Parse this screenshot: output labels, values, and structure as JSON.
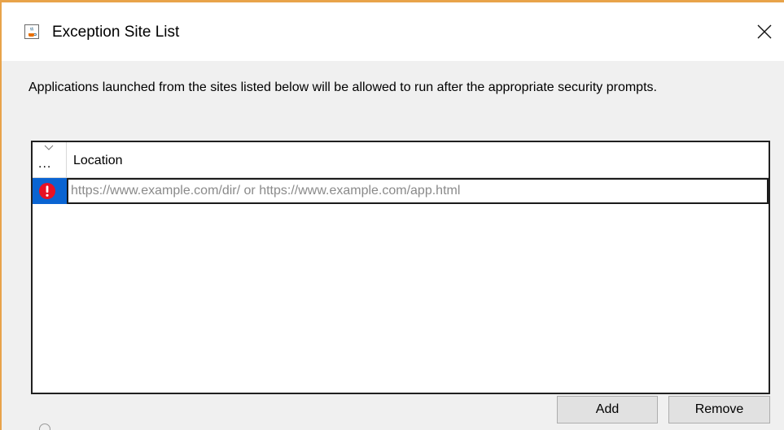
{
  "window": {
    "title": "Exception Site List",
    "accent_color": "#e8a34a"
  },
  "icons": {
    "app": "java-cup-icon",
    "close": "close-icon",
    "sort": "chevron-down-icon",
    "warning": "error-icon"
  },
  "description": "Applications launched from the sites listed below will be allowed to run after the appropriate security prompts.",
  "table": {
    "columns": {
      "status": "...",
      "location": "Location"
    },
    "rows": [
      {
        "status": "error",
        "location_value": "",
        "location_placeholder": "https://www.example.com/dir/ or https://www.example.com/app.html"
      }
    ],
    "selected_row_color": "#0a64d2",
    "error_color": "#e81123"
  },
  "buttons": {
    "add": "Add",
    "remove": "Remove"
  }
}
